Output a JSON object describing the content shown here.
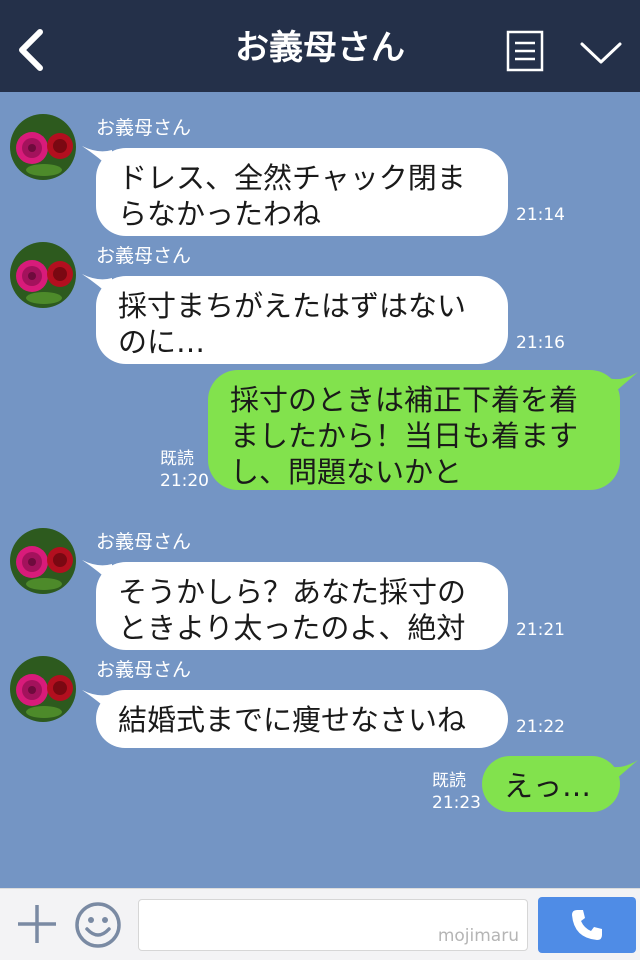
{
  "header": {
    "title": "お義母さん",
    "back_icon": "chevron-left-icon",
    "menu_icon": "notes-icon",
    "dropdown_icon": "chevron-down-icon",
    "bg_color": "#243049"
  },
  "chat": {
    "bg_color": "#7495c4",
    "incoming_bubble_color": "#ffffff",
    "outgoing_bubble_color": "#82e24d",
    "messages": [
      {
        "direction": "in",
        "sender": "お義母さん",
        "lines": [
          "ドレス、全然チャック閉ま",
          "らなかったわね"
        ],
        "time": "21:14"
      },
      {
        "direction": "in",
        "sender": "お義母さん",
        "lines": [
          "採寸まちがえたはずはない",
          "のに…"
        ],
        "time": "21:16"
      },
      {
        "direction": "out",
        "lines": [
          "採寸のときは補正下着を着",
          "ましたから！当日も着ます",
          "し、問題ないかと"
        ],
        "read": "既読",
        "time": "21:20"
      },
      {
        "direction": "in",
        "sender": "お義母さん",
        "lines": [
          "そうかしら？あなた採寸の",
          "ときより太ったのよ、絶対"
        ],
        "time": "21:21"
      },
      {
        "direction": "in",
        "sender": "お義母さん",
        "lines": [
          "結婚式までに痩せなさいね"
        ],
        "time": "21:22"
      },
      {
        "direction": "out",
        "lines": [
          "えっ…"
        ],
        "read": "既読",
        "time": "21:23"
      }
    ]
  },
  "footer": {
    "plus_icon": "plus-icon",
    "sticker_icon": "smile-icon",
    "input_value": "",
    "watermark": "mojimaru",
    "call_icon": "phone-icon",
    "call_color": "#4f8ce6"
  }
}
